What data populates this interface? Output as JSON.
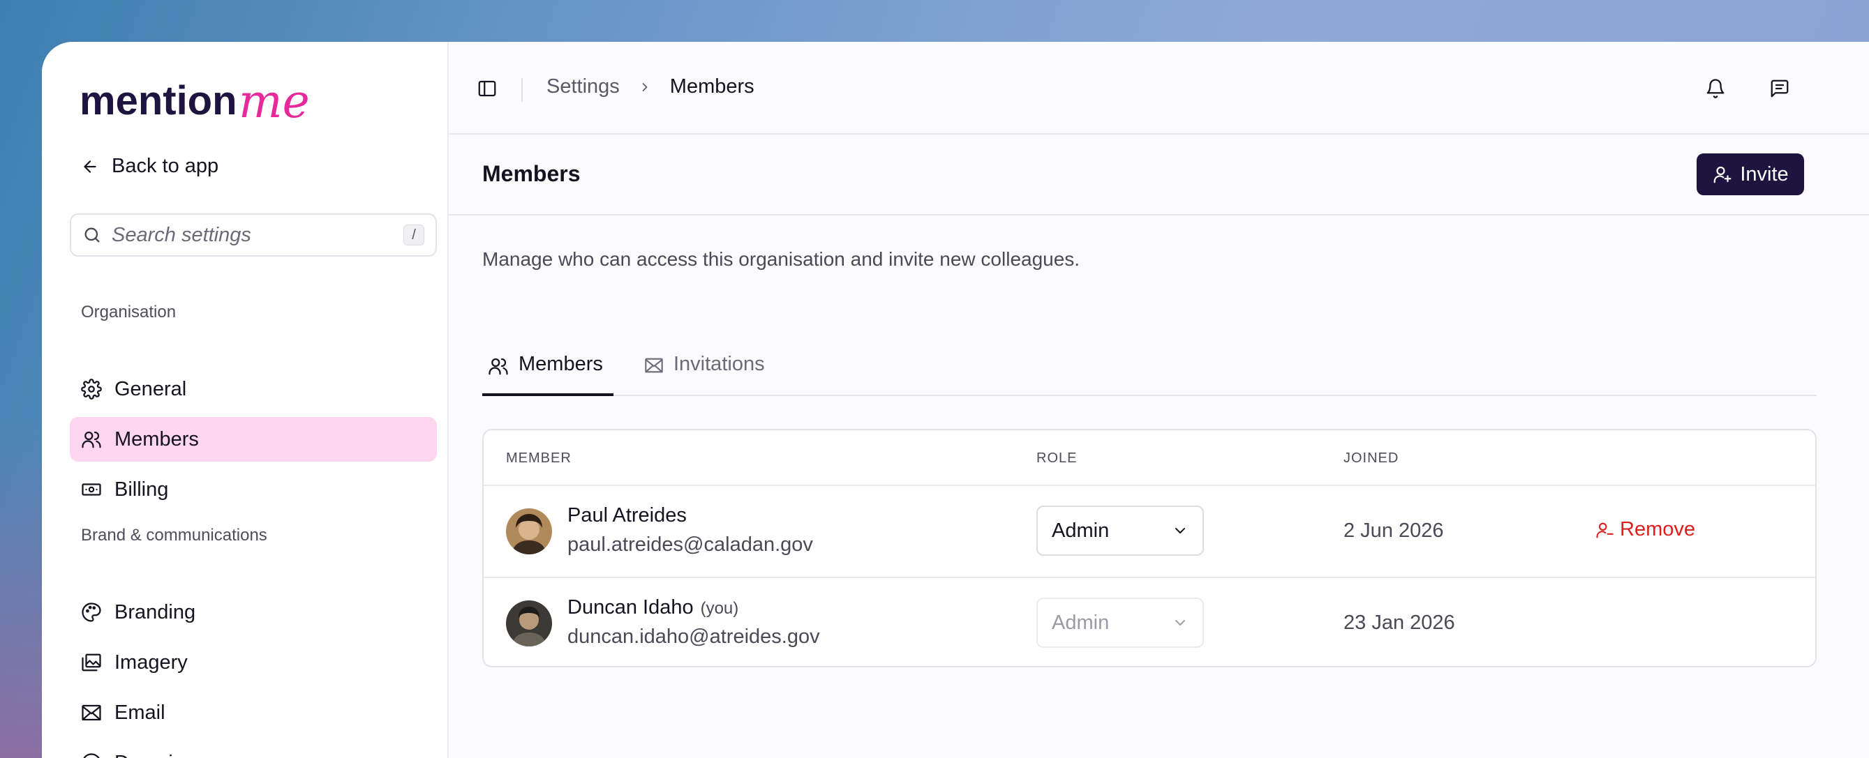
{
  "brand": {
    "wordmark_main": "mention",
    "wordmark_script": "me",
    "main_color": "#1e1440",
    "accent_color": "#e8299b"
  },
  "sidebar": {
    "back_label": "Back to app",
    "search_placeholder": "Search settings",
    "search_shortcut": "/",
    "sections": [
      {
        "label": "Organisation",
        "items": [
          {
            "label": "General",
            "icon": "gear-icon"
          },
          {
            "label": "Members",
            "icon": "users-icon",
            "active": true
          },
          {
            "label": "Billing",
            "icon": "banknote-icon"
          }
        ]
      },
      {
        "label": "Brand & communications",
        "items": [
          {
            "label": "Branding",
            "icon": "palette-icon"
          },
          {
            "label": "Imagery",
            "icon": "images-icon"
          },
          {
            "label": "Email",
            "icon": "mail-icon"
          },
          {
            "label": "Domain",
            "icon": "at-sign-icon"
          }
        ]
      }
    ]
  },
  "topbar": {
    "breadcrumb": [
      "Settings",
      "Members"
    ]
  },
  "header": {
    "title": "Members",
    "invite_label": "Invite"
  },
  "description": "Manage who can access this organisation and invite new colleagues.",
  "tabs": [
    {
      "label": "Members",
      "icon": "users-icon",
      "active": true
    },
    {
      "label": "Invitations",
      "icon": "mail-icon",
      "active": false
    }
  ],
  "table": {
    "columns": [
      "MEMBER",
      "ROLE",
      "JOINED"
    ],
    "rows": [
      {
        "name": "Paul Atreides",
        "you": "",
        "email": "paul.atreides@caladan.gov",
        "role": "Admin",
        "role_editable": true,
        "joined": "2 Jun 2026",
        "action": "Remove"
      },
      {
        "name": "Duncan Idaho",
        "you": "(you)",
        "email": "duncan.idaho@atreides.gov",
        "role": "Admin",
        "role_editable": false,
        "joined": "23 Jan 2026",
        "action": ""
      }
    ]
  },
  "colors": {
    "active_nav_bg": "#ffd6ef",
    "primary_button": "#1e1440",
    "danger": "#dc1f1f"
  }
}
